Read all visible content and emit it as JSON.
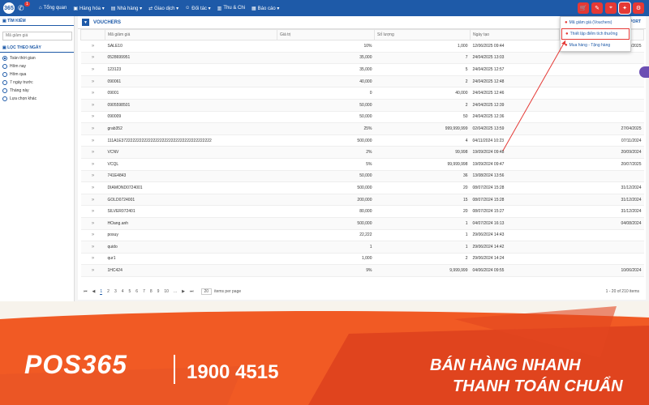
{
  "app": {
    "logo_text": "365",
    "phone_badge": "1"
  },
  "nav": {
    "items": [
      {
        "icon": "⌂",
        "label": "Tổng quan"
      },
      {
        "icon": "▣",
        "label": "Hàng hóa ▾"
      },
      {
        "icon": "▤",
        "label": "Nhà hàng ▾"
      },
      {
        "icon": "⇄",
        "label": "Giao dịch ▾"
      },
      {
        "icon": "☺",
        "label": "Đối tác ▾"
      },
      {
        "icon": "▥",
        "label": "Thu & Chi"
      },
      {
        "icon": "▦",
        "label": "Báo cáo ▾"
      }
    ]
  },
  "sidebar": {
    "search_title": "Tìm kiếm",
    "search_placeholder": "Mã giảm giá",
    "filter_title": "Lọc theo ngày",
    "options": [
      "Toàn thời gian",
      "Hôm nay",
      "Hôm qua",
      "7 ngày trước",
      "Tháng này",
      "Lựa chọn khác"
    ],
    "selected": "Toàn thời gian"
  },
  "main": {
    "title": "VOUCHERS",
    "export_label": "PORT"
  },
  "table": {
    "headers": [
      "",
      "Mã giảm giá",
      "Giá trị",
      "Số lượng",
      "Ngày tạo",
      ""
    ],
    "rows": [
      [
        "»",
        "SALE10",
        "10%",
        "1,000",
        "12/06/2025 09:44",
        "18/06/2025"
      ],
      [
        "»",
        "0528699951",
        "35,000",
        "7",
        "24/04/2025 13:03",
        ""
      ],
      [
        "»",
        "123123",
        "35,000",
        "5",
        "24/04/2025 12:57",
        ""
      ],
      [
        "»",
        "090061",
        "40,000",
        "2",
        "24/04/2025 12:48",
        ""
      ],
      [
        "»",
        "09001",
        "0",
        "40,000",
        "24/04/2025 12:46",
        ""
      ],
      [
        "»",
        "0905598501",
        "50,000",
        "2",
        "24/04/2025 12:39",
        ""
      ],
      [
        "»",
        "090009",
        "50,000",
        "50",
        "24/04/2025 12:36",
        ""
      ],
      [
        "»",
        "grab352",
        "25%",
        "999,999,999",
        "02/04/2025 13:59",
        "27/04/2025"
      ],
      [
        "»",
        "111A1E3722222222222222222222222222222222222222",
        "500,000",
        "4",
        "04/11/2024 10:23",
        "07/11/2024"
      ],
      [
        "»",
        "VCNV",
        "2%",
        "99,998",
        "19/09/2024 09:48",
        "20/09/2024"
      ],
      [
        "»",
        "VCQL",
        "5%",
        "99,999,998",
        "19/09/2024 09:47",
        "20/07/2025"
      ],
      [
        "»",
        "741E4843",
        "50,000",
        "36",
        "13/08/2024 13:56",
        ""
      ],
      [
        "»",
        "DIAMOND0724001",
        "500,000",
        "20",
        "08/07/2024 15:28",
        "31/12/2024"
      ],
      [
        "»",
        "GOLD0724001",
        "200,000",
        "15",
        "08/07/2024 15:28",
        "31/12/2024"
      ],
      [
        "»",
        "SILVER072401",
        "80,000",
        "20",
        "08/07/2024 15:27",
        "31/12/2024"
      ],
      [
        "»",
        "HOang.anh",
        "500,000",
        "1",
        "04/07/2024 16:13",
        "04/08/2024"
      ],
      [
        "»",
        "posuy",
        "22,222",
        "1",
        "29/06/2024 14:43",
        ""
      ],
      [
        "»",
        "quido",
        "1",
        "1",
        "29/06/2024 14:42",
        ""
      ],
      [
        "»",
        "qur1",
        "1,000",
        "2",
        "29/06/2024 14:24",
        ""
      ],
      [
        "»",
        "1HC424",
        "9%",
        "9,999,999",
        "04/06/2024 09:55",
        "10/06/2024"
      ]
    ]
  },
  "pager": {
    "first": "⏮",
    "prev": "◀",
    "pages": [
      "1",
      "2",
      "3",
      "4",
      "5",
      "6",
      "7",
      "8",
      "9",
      "10",
      "..."
    ],
    "next": "▶",
    "last": "⏭",
    "per_page": "20",
    "per_page_label": "items per page",
    "info": "1 - 20 of 210 items"
  },
  "dropdown": {
    "items": [
      {
        "icon": "●",
        "label": "Mã giảm giá (Vouchers)"
      },
      {
        "icon": "●",
        "label": "Thiết lập điểm tích thưởng"
      },
      {
        "icon": "●",
        "label": "Mua hàng - Tặng hàng"
      }
    ]
  },
  "banner": {
    "brand": "POS365",
    "hotline": "1900 4515",
    "slogan1": "BÁN HÀNG NHANH",
    "slogan2": "THANH TOÁN CHUẨN",
    "color_primary": "#f15a24",
    "color_dark": "#d93b1c"
  },
  "colors": {
    "nav": "#1e5aa8",
    "accent": "#e53935"
  }
}
